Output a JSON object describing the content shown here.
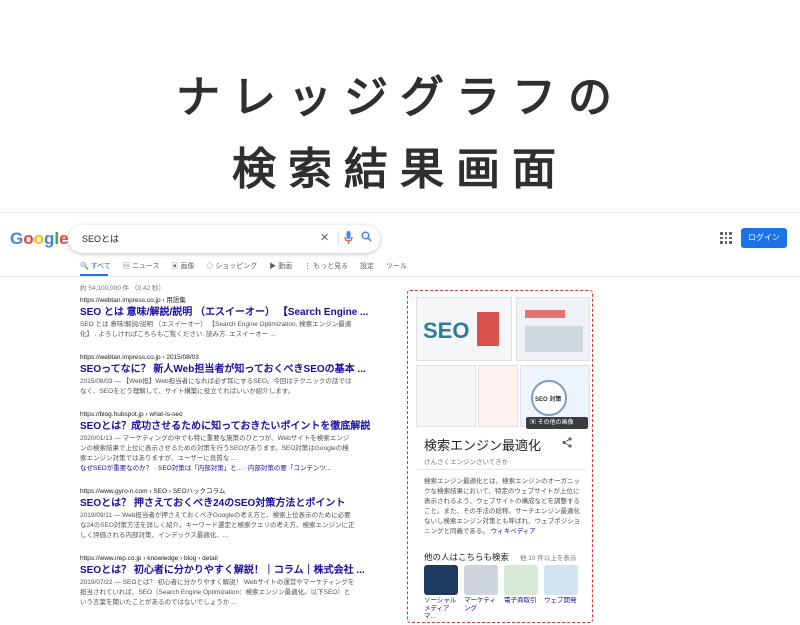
{
  "headline": {
    "line1": "ナレッジグラフの",
    "line2": "検索結果画面"
  },
  "google": {
    "logo": "Google",
    "logo_colors": [
      "#4285F4",
      "#EA4335",
      "#FBBC05",
      "#4285F4",
      "#34A853",
      "#EA4335"
    ],
    "query": "SEOとは",
    "login_label": "ログイン",
    "tabs": [
      "すべて",
      "ニュース",
      "画像",
      "ショッピング",
      "動画",
      "もっと見る",
      "設定",
      "ツール"
    ],
    "stats": "約 54,100,000 件 （0.42 秒）"
  },
  "results": [
    {
      "url": "https://webtan.impress.co.jp › 用語集",
      "title": "SEO とは 意味/解説/説明 （エスイーオー） 【Search Engine ...",
      "snippet": "SEO とは 意味/解説/説明 （エスイーオー） 【Search Engine Optimization, 検索エンジン最適化】 . よろしければこちらもご覧ください. 読み方. エスイーオー ..."
    },
    {
      "url": "https://webtan.impress.co.jp › 2015/08/03",
      "title": "SEOってなに？ 新人Web担当者が知っておくべきSEOの基本 ...",
      "snippet": "2015/08/03 — 【Web担】Web担当者になれば必ず耳にするSEO。今回はテクニックの話ではなく、SEOをどう理解して、サイト構築に役立てればいいか紹介します。"
    },
    {
      "url": "https://blog.hubspot.jp › what-is-seo",
      "title": "SEOとは？成功させるために知っておきたいポイントを徹底解説",
      "snippet": "2020/01/13 — マーケティングの中でも特に重要な施策のひとつが、Webサイトを検索エンジンの検索結果で上位に表示させるための対策を行うSEOがあります。SEO対策はGoogleの検索エンジン対策ではありますが、ユーザーに良質な ...",
      "links": "なぜSEOが重要なのか？ · SEO対策は「内部対策」と... · 内部対策の要「コンテンツ..."
    },
    {
      "url": "https://www.gyro-n.com › SEO › SEOハックコラム",
      "title": "SEOとは？ 押さえておくべき24のSEO対策方法とポイント",
      "snippet": "2019/09/11 — Web担当者が押さえておくべきGoogleの考え方と、検索上位表示のために必要な24のSEO対策方法を詳しく紹介。キーワード選定と検索クエリの考え方、検索エンジンに正しく評価される内部対策、インデックス最適化、..."
    },
    {
      "url": "https://www.irep.co.jp › knowledge › blog › detail",
      "title": "SEOとは？ 初心者に分かりやすく解説！｜コラム｜株式会社 ...",
      "snippet": "2019/07/22 — SEOとは？ 初心者に分かりやすく解説！ Webサイトの運営やマーケティングを担当されていれば、SEO（Search Engine Optimization：検索エンジン最適化。以下SEO）という言葉を聞いたことがあるのではないでしょうか ..."
    }
  ],
  "knowledge_panel": {
    "image_texts": {
      "seo": "SEO",
      "seo_taisaku": "SEO 対策"
    },
    "more_images": "その他の画像",
    "title": "検索エンジン最適化",
    "reading": "けんさくエンジンさいてきか",
    "description": "検索エンジン最適化とは、検索エンジンのオーガニックな検索結果において、特定のウェブサイトが上位に表示されるよう、ウェブサイトの構成などを調整すること。また、その手法の総称。サーチエンジン最適化ないし検索エンジン対策とも呼ばれ、ウェブポジショニングと同義である。",
    "wiki": "ウィキペディア",
    "also_searched": "他の人はこちらも検索",
    "also_more": "他 10 件以上を表示",
    "cards": [
      {
        "label": "ソーシャルメディアマ...",
        "color": "#1e3a5f"
      },
      {
        "label": "マーケティング",
        "color": "#cfd5dc"
      },
      {
        "label": "電子商取引",
        "color": "#d7e8d6"
      },
      {
        "label": "ウェブ開発",
        "color": "#cfe3f2"
      }
    ],
    "accent_color": "#dd3333"
  }
}
